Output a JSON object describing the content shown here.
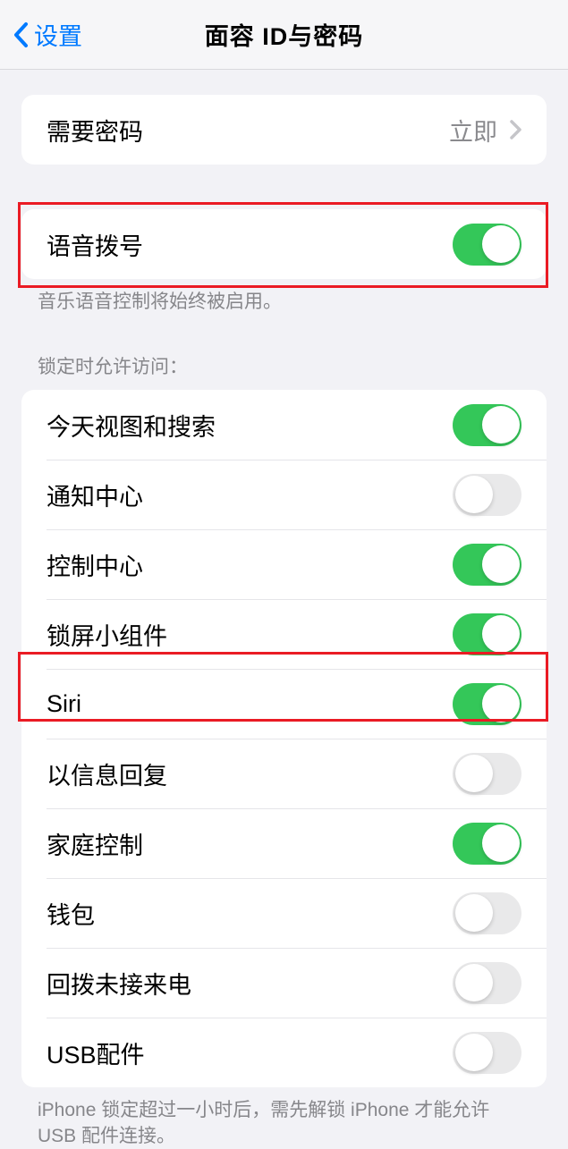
{
  "header": {
    "back_label": "设置",
    "title": "面容 ID与密码"
  },
  "group1": {
    "require_passcode": {
      "label": "需要密码",
      "value": "立即"
    }
  },
  "group2": {
    "voice_dial": {
      "label": "语音拨号",
      "on": true
    },
    "footer": "音乐语音控制将始终被启用。"
  },
  "group3": {
    "header": "锁定时允许访问：",
    "items": [
      {
        "label": "今天视图和搜索",
        "on": true
      },
      {
        "label": "通知中心",
        "on": false
      },
      {
        "label": "控制中心",
        "on": true
      },
      {
        "label": "锁屏小组件",
        "on": true
      },
      {
        "label": "Siri",
        "on": true
      },
      {
        "label": "以信息回复",
        "on": false
      },
      {
        "label": "家庭控制",
        "on": true
      },
      {
        "label": "钱包",
        "on": false
      },
      {
        "label": "回拨未接来电",
        "on": false
      },
      {
        "label": "USB配件",
        "on": false
      }
    ],
    "footer": "iPhone 锁定超过一小时后，需先解锁 iPhone 才能允许 USB 配件连接。"
  }
}
